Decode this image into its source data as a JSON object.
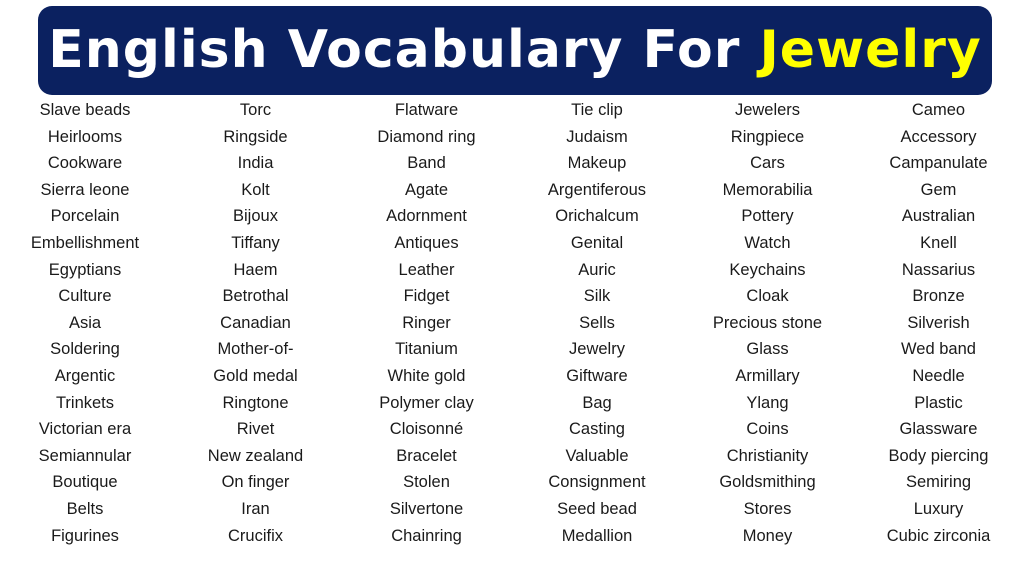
{
  "header": {
    "title_prefix": "English Vocabulary For",
    "title_highlight": "Jewelry",
    "background_color": "#0b2160",
    "text_color": "#ffffff",
    "highlight_color": "#ffff00"
  },
  "columns": [
    {
      "words": [
        "Slave beads",
        "Heirlooms",
        "Cookware",
        "Sierra leone",
        "Porcelain",
        "Embellishment",
        "Egyptians",
        "Culture",
        "Asia",
        "Soldering",
        "Argentic",
        "Trinkets",
        "Victorian era",
        "Semiannular",
        "Boutique",
        "Belts",
        "Figurines"
      ]
    },
    {
      "words": [
        "Torc",
        "Ringside",
        "India",
        "Kolt",
        "Bijoux",
        "Tiffany",
        "Haem",
        "Betrothal",
        "Canadian",
        "Mother-of-",
        "Gold medal",
        "Ringtone",
        "Rivet",
        "New zealand",
        "On finger",
        "Iran",
        "Crucifix"
      ]
    },
    {
      "words": [
        "Flatware",
        "Diamond ring",
        "Band",
        "Agate",
        "Adornment",
        "Antiques",
        "Leather",
        "Fidget",
        "Ringer",
        "Titanium",
        "White gold",
        "Polymer clay",
        "Cloisonné",
        "Bracelet",
        "Stolen",
        "Silvertone",
        "Chainring"
      ]
    },
    {
      "words": [
        "Tie clip",
        "Judaism",
        "Makeup",
        "Argentiferous",
        "Orichalcum",
        "Genital",
        "Auric",
        "Silk",
        "Sells",
        "Jewelry",
        "Giftware",
        "Bag",
        "Casting",
        "Valuable",
        "Consignment",
        "Seed bead",
        "Medallion"
      ]
    },
    {
      "words": [
        "Jewelers",
        "Ringpiece",
        "Cars",
        "Memorabilia",
        "Pottery",
        "Watch",
        "Keychains",
        "Cloak",
        "Precious stone",
        "Glass",
        "Armillary",
        "Ylang",
        "Coins",
        "Christianity",
        "Goldsmithing",
        "Stores",
        "Money"
      ]
    },
    {
      "words": [
        "Cameo",
        "Accessory",
        "Campanulate",
        "Gem",
        "Australian",
        "Knell",
        "Nassarius",
        "Bronze",
        "Silverish",
        "Wed band",
        "Needle",
        "Plastic",
        "Glassware",
        "Body piercing",
        "Semiring",
        "Luxury",
        "Cubic zirconia"
      ]
    }
  ]
}
